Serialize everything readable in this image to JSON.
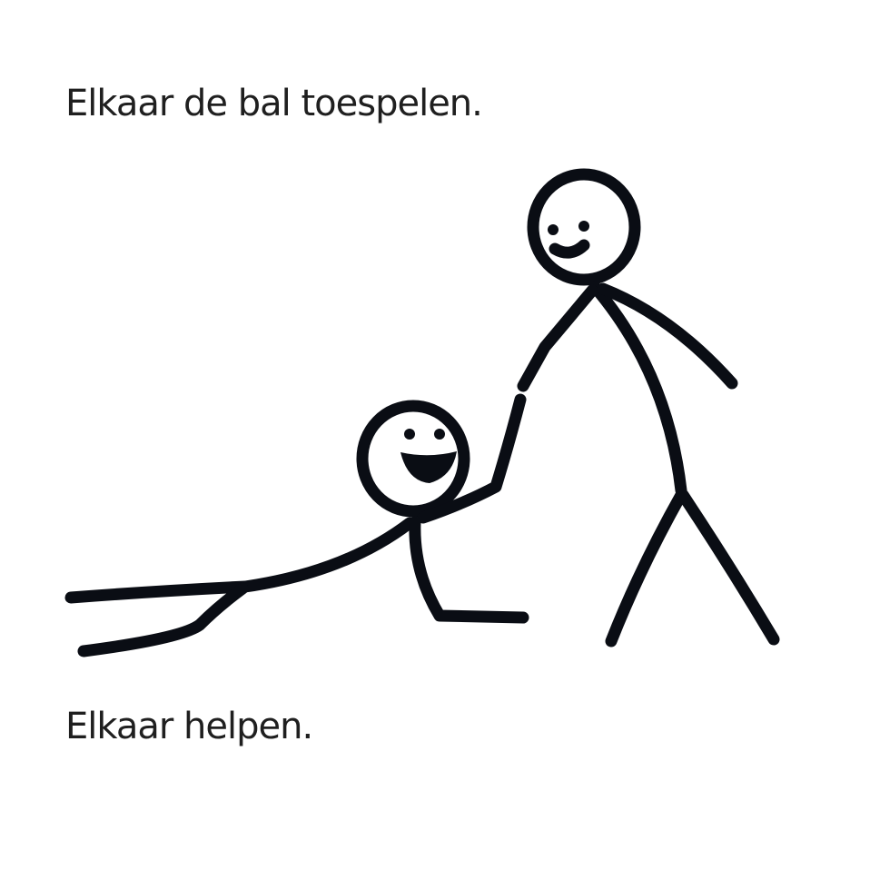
{
  "captions": {
    "top": "Elkaar de bal toespelen.",
    "bottom": "Elkaar helpen."
  },
  "colors": {
    "background": "#ffffff",
    "text": "#1f1f1f",
    "ink": "#0a0d14"
  },
  "figures": {
    "standing": "standing-stick-figure",
    "lying": "lying-stick-figure"
  }
}
